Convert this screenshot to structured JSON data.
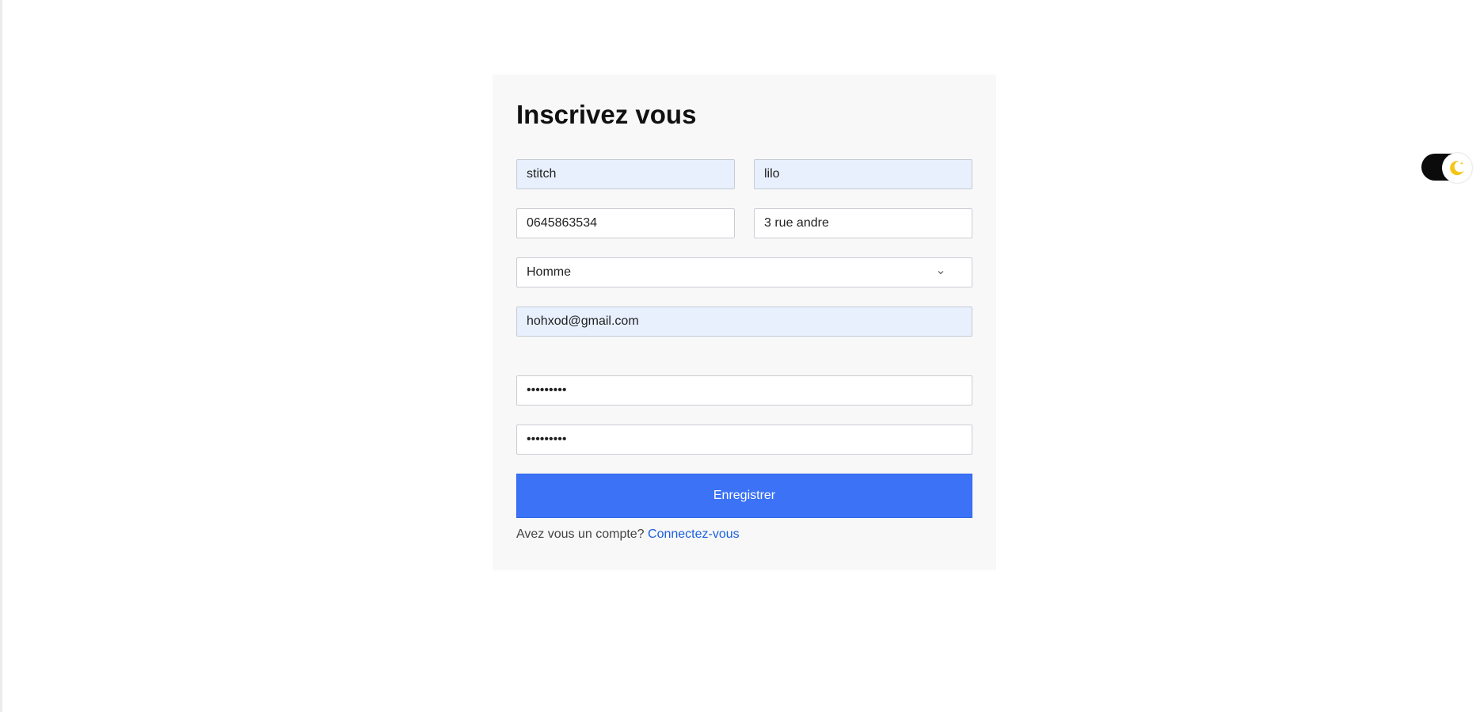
{
  "form": {
    "title": "Inscrivez vous",
    "nom": "stitch",
    "prenom": "lilo",
    "telephone": "0645863534",
    "adresse": "3 rue andre",
    "genre": "Homme",
    "email": "hohxod@gmail.com",
    "password": "•••••••••",
    "password_confirm": "•••••••••",
    "submit_label": "Enregistrer",
    "footer_text": "Avez vous un compte?",
    "footer_link": "Connectez-vous"
  },
  "icons": {
    "chevron": "chevron-down-icon",
    "theme_toggle": "moon-icon"
  },
  "colors": {
    "accent": "#3b72f6",
    "link": "#1a5fe0",
    "autofill_bg": "#e8f0fe",
    "card_bg": "#f8f8f8",
    "toggle_track": "#0b0b0b",
    "moon": "#f5c518"
  }
}
